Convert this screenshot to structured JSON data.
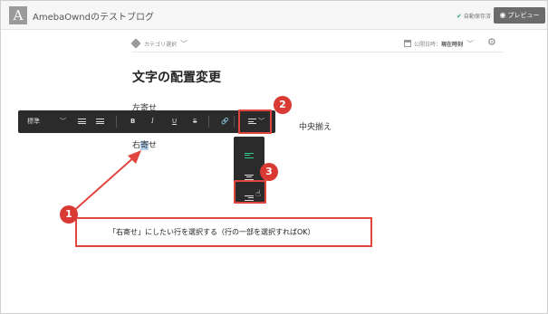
{
  "header": {
    "logo_letter": "A",
    "site_title": "AmebaOwndのテストブログ",
    "autosave_label": "自動保存済",
    "preview_label": "プレビュー"
  },
  "meta": {
    "category_label": "カテゴリ選択",
    "publish_label": "公開日時：",
    "publish_value": "現在時刻"
  },
  "article": {
    "title": "文字の配置変更",
    "para_left": "左寄せ",
    "para_center": "中央揃え",
    "para_right_pre": "右",
    "para_right_sel": "寄",
    "para_right_post": "せ"
  },
  "toolbar": {
    "style_label": "標準",
    "bold": "B",
    "italic": "I",
    "underline": "U",
    "strike": "S"
  },
  "icons": {
    "tag": "tag-icon",
    "calendar": "calendar-icon",
    "gear": "gear-icon",
    "eye": "eye-icon",
    "check": "check-icon",
    "link": "link-icon",
    "cursor": "hand-cursor-icon"
  },
  "callouts": {
    "badge_1": "1",
    "badge_2": "2",
    "badge_3": "3",
    "instruction": "「右寄せ」にしたい行を選択する（行の一部を選択すればOK）"
  },
  "colors": {
    "accent_red": "#d93a34",
    "toolbar_bg": "#2b2b2b",
    "active_green": "#2ecc8a",
    "selection": "#b6d2ef"
  }
}
